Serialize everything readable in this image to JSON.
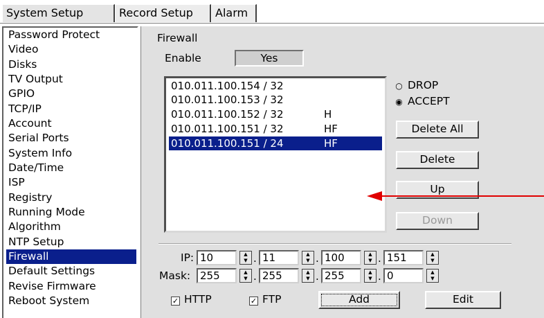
{
  "tabs": [
    {
      "label": "System Setup"
    },
    {
      "label": "Record Setup"
    },
    {
      "label": "Alarm"
    }
  ],
  "sidebar": {
    "items": [
      {
        "label": "Password Protect"
      },
      {
        "label": "Video"
      },
      {
        "label": "Disks"
      },
      {
        "label": "TV Output"
      },
      {
        "label": "GPIO"
      },
      {
        "label": "TCP/IP"
      },
      {
        "label": "Account"
      },
      {
        "label": "Serial Ports"
      },
      {
        "label": "System Info"
      },
      {
        "label": "Date/Time"
      },
      {
        "label": "ISP"
      },
      {
        "label": "Registry"
      },
      {
        "label": "Running Mode"
      },
      {
        "label": "Algorithm"
      },
      {
        "label": "NTP Setup"
      },
      {
        "label": "Firewall"
      },
      {
        "label": "Default Settings"
      },
      {
        "label": "Revise Firmware"
      },
      {
        "label": "Reboot System"
      }
    ],
    "selected": "Firewall"
  },
  "firewall": {
    "title": "Firewall",
    "enable_label": "Enable",
    "enable_value": "Yes",
    "rules": [
      {
        "address": "010.011.100.154 / 32",
        "flags": ""
      },
      {
        "address": "010.011.100.153 / 32",
        "flags": ""
      },
      {
        "address": "010.011.100.152 / 32",
        "flags": "H"
      },
      {
        "address": "010.011.100.151 / 32",
        "flags": "HF"
      },
      {
        "address": "010.011.100.151 / 24",
        "flags": "HF"
      }
    ],
    "selected_rule_index": 4,
    "policy": {
      "drop_label": "DROP",
      "accept_label": "ACCEPT",
      "selected": "ACCEPT"
    },
    "buttons": {
      "delete_all": "Delete All",
      "delete": "Delete",
      "up": "Up",
      "down": "Down",
      "add": "Add",
      "edit": "Edit"
    },
    "ip_label": "IP:",
    "ip": [
      "10",
      "11",
      "100",
      "151"
    ],
    "mask_label": "Mask:",
    "mask": [
      "255",
      "255",
      "255",
      "0"
    ],
    "octet_separator": ".",
    "http_label": "HTTP",
    "http_checked": true,
    "ftp_label": "FTP",
    "ftp_checked": true
  },
  "colors": {
    "selection": "#0a1f8c",
    "annotation_arrow": "#e00000",
    "panel_bg": "#e0e0e0"
  }
}
